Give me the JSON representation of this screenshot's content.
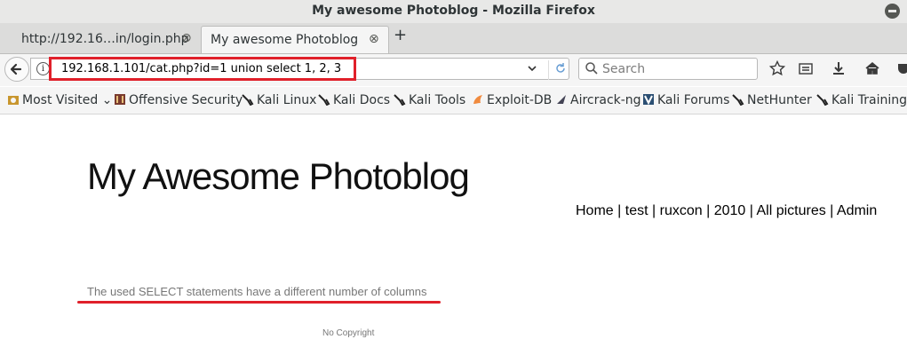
{
  "window": {
    "title": "My awesome Photoblog - Mozilla Firefox"
  },
  "tabs": [
    {
      "label": "http://192.16…in/login.php",
      "active": false
    },
    {
      "label": "My awesome Photoblog",
      "active": true
    }
  ],
  "tab_close_glyph": "⊗",
  "new_tab_glyph": "+",
  "urlbar": {
    "value": "192.168.1.101/cat.php?id=1 union select 1, 2, 3"
  },
  "search": {
    "placeholder": "Search"
  },
  "bookmarks": [
    {
      "label": "Most Visited",
      "icon": "gear-icon"
    },
    {
      "label": "Offensive Security",
      "icon": "offsec-icon"
    },
    {
      "label": "Kali Linux",
      "icon": "kali-dragon-icon"
    },
    {
      "label": "Kali Docs",
      "icon": "kali-dragon-icon"
    },
    {
      "label": "Kali Tools",
      "icon": "kali-dragon-icon"
    },
    {
      "label": "Exploit-DB",
      "icon": "exploitdb-icon"
    },
    {
      "label": "Aircrack-ng",
      "icon": "aircrack-icon"
    },
    {
      "label": "Kali Forums",
      "icon": "kali-forums-icon"
    },
    {
      "label": "NetHunter",
      "icon": "kali-dragon-icon"
    },
    {
      "label": "Kali Training",
      "icon": "kali-dragon-icon"
    }
  ],
  "page": {
    "site_title": "My Awesome Photoblog",
    "nav": [
      "Home",
      "test",
      "ruxcon",
      "2010",
      "All pictures",
      "Admin"
    ],
    "nav_separator": "|",
    "error_message": "The used SELECT statements have a different number of columns",
    "footer": "No Copyright"
  },
  "colors": {
    "annotation_red": "#e0202a"
  }
}
